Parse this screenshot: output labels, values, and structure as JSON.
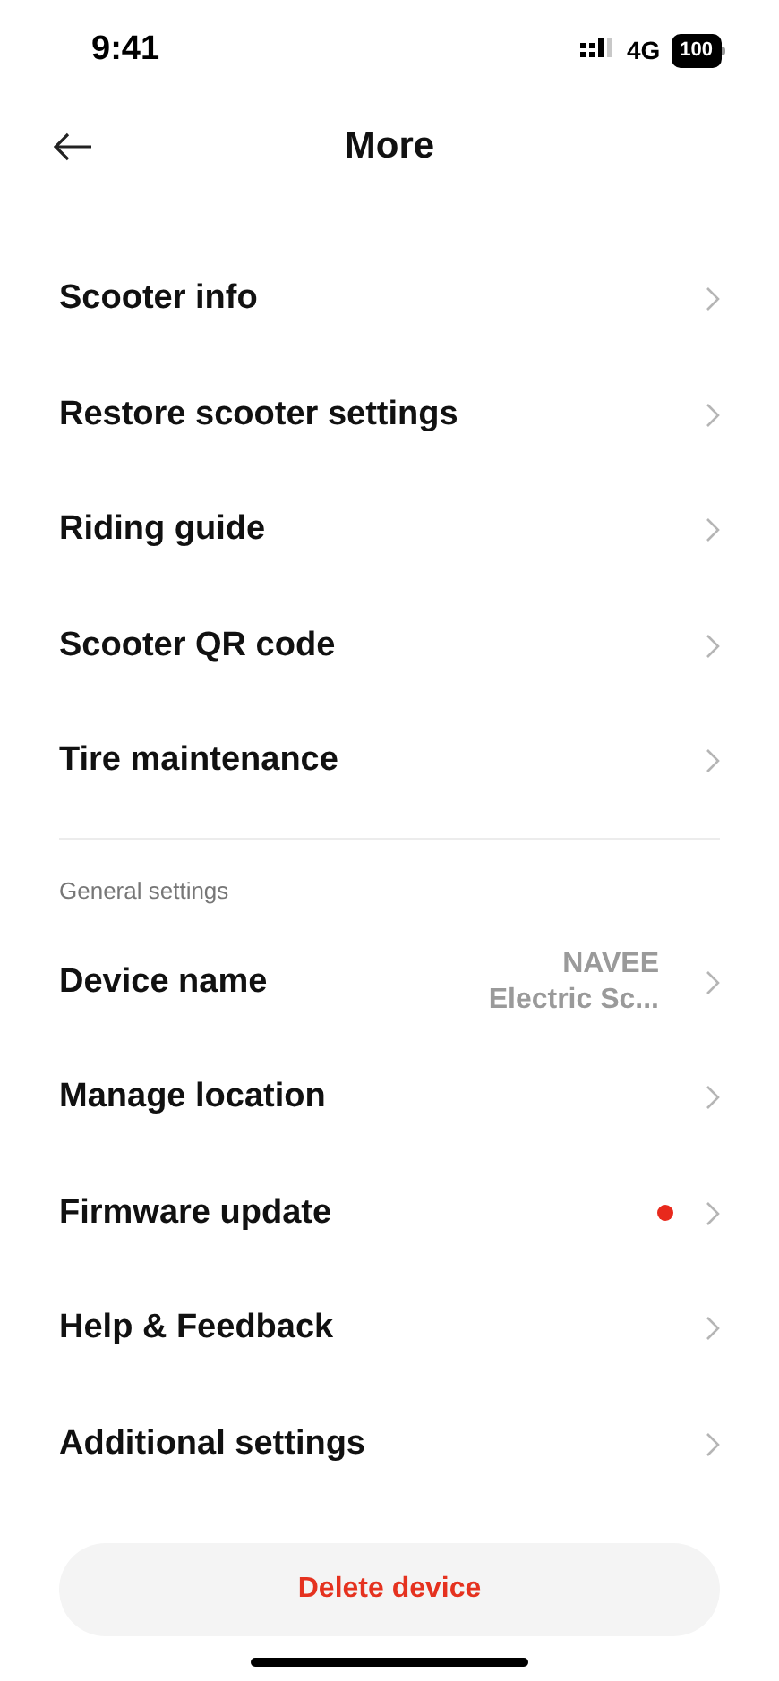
{
  "status_bar": {
    "time": "9:41",
    "network": "4G",
    "battery": "100"
  },
  "header": {
    "title": "More"
  },
  "items": [
    {
      "label": "Scooter info"
    },
    {
      "label": "Restore scooter settings"
    },
    {
      "label": "Riding guide"
    },
    {
      "label": "Scooter QR code"
    },
    {
      "label": "Tire maintenance"
    }
  ],
  "general_settings": {
    "heading": "General settings",
    "items": [
      {
        "label": "Device name",
        "value_lines": [
          "NAVEE",
          "Electric Sc..."
        ],
        "badge": false
      },
      {
        "label": "Manage location",
        "badge": false
      },
      {
        "label": "Firmware update",
        "badge": true
      },
      {
        "label": "Help & Feedback",
        "badge": false
      },
      {
        "label": "Additional settings",
        "badge": false
      }
    ]
  },
  "delete_button": {
    "label": "Delete device"
  }
}
